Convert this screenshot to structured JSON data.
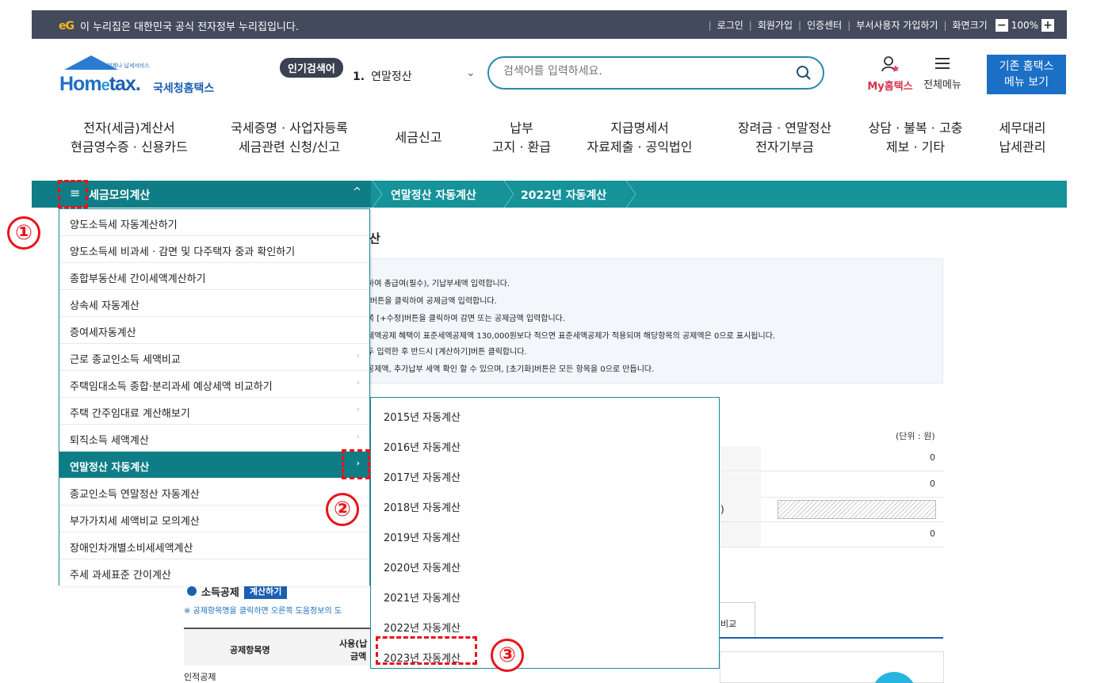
{
  "gov_bar": {
    "logo": "eG",
    "notice": "이 누리집은 대한민국 공식 전자정부 누리집입니다.",
    "links": [
      "로그인",
      "회원가입",
      "인증센터",
      "부서사용자 가입하기"
    ],
    "zoom_label": "화면크기",
    "zoom_minus": "−",
    "zoom_value": "100%",
    "zoom_plus": "+"
  },
  "header": {
    "logo_sub": "언제나 납세서비스",
    "logo_home": "Hom",
    "logo_e": "e",
    "logo_tax": "tax.",
    "logo_kr": "국세청홈택스",
    "popular_badge": "인기검색어",
    "popular_rank": "1.",
    "popular_keyword": "연말정산",
    "search_placeholder": "검색어를 입력하세요.",
    "my_label": "My홈택스",
    "allmenu_label": "전체메뉴",
    "old_menu_line1": "기존 홈택스",
    "old_menu_line2": "메뉴 보기"
  },
  "gnb": [
    {
      "l1": "전자(세금)계산서",
      "l2": "현금영수증 · 신용카드"
    },
    {
      "l1": "국세증명 · 사업자등록",
      "l2": "세금관련 신청/신고"
    },
    {
      "l1": "세금신고",
      "l2": ""
    },
    {
      "l1": "납부",
      "l2": "고지 · 환급"
    },
    {
      "l1": "지급명세서",
      "l2": "자료제출 · 공익법인"
    },
    {
      "l1": "장려금 · 연말정산",
      "l2": "전자기부금"
    },
    {
      "l1": "상담 · 불복 · 고충",
      "l2": "제보 · 기타"
    },
    {
      "l1": "세무대리",
      "l2": "납세관리"
    }
  ],
  "breadcrumb": {
    "menu_icon": "≡",
    "title": "세금모의계산",
    "toggle": "^",
    "crumb1": "연말정산 자동계산",
    "crumb2": "2022년 자동계산"
  },
  "menu": {
    "items": [
      {
        "label": "양도소득세 자동계산하기",
        "arrow": ""
      },
      {
        "label": "양도소득세 비과세 · 감면 및 다주택자 중과 확인하기",
        "arrow": ""
      },
      {
        "label": "종합부동산세 간이세액계산하기",
        "arrow": ""
      },
      {
        "label": "상속세 자동계산",
        "arrow": ""
      },
      {
        "label": "증여세자동계산",
        "arrow": ""
      },
      {
        "label": "근로 종교인소득 세액비교",
        "arrow": "›"
      },
      {
        "label": "주택임대소득 종합·분리과세 예상세액 비교하기",
        "arrow": "›"
      },
      {
        "label": "주택 간주임대료 계산해보기",
        "arrow": "›"
      },
      {
        "label": "퇴직소득 세액계산",
        "arrow": "›"
      },
      {
        "label": "연말정산 자동계산",
        "arrow": "›"
      },
      {
        "label": "종교인소득 연말정산 자동계산",
        "arrow": ""
      },
      {
        "label": "부가가치세 세액비교 모의계산",
        "arrow": ""
      },
      {
        "label": "장애인차개별소비세세액계산",
        "arrow": ""
      },
      {
        "label": "주세 과세표준 간이계산",
        "arrow": ""
      }
    ]
  },
  "submenu": {
    "items": [
      "2015년 자동계산",
      "2016년 자동계산",
      "2017년 자동계산",
      "2018년 자동계산",
      "2019년 자동계산",
      "2020년 자동계산",
      "2021년 자동계산",
      "2022년 자동계산",
      "2023년 자동계산"
    ]
  },
  "background": {
    "page_title": "산",
    "guide_lines": [
      "하여 총급여(필수), 기납부세액 입력합니다.",
      "]버튼을 클릭하여 공제금액 입력합니다.",
      "쪽 [+수정]버튼을 클릭하여 감면 또는 공제금액 입력합니다.",
      "세액공제 혜택이 표준세액공제액 130,000원보다 적으면 표준세액공제가 적용되며 해당항목의 공제액은 0으로 표시됩니다.",
      "두 입력한 후 반드시 [계산하기]버튼 클릭합니다.",
      "공제액, 추가납부 세액 확인 할 수 있으며, [초기화]버튼은 모든 항목을 0으로 만듭니다."
    ],
    "unit": "(단위 : 원)",
    "row_values": [
      "0",
      "0",
      "",
      "0"
    ],
    "paren": ")",
    "section_title": "소득공제",
    "section_button": "계산하기",
    "note": "※ 공제항목명을 클릭하면 오른쪽 도움정보의 도",
    "tab_label": "비교",
    "th1": "공제항목명",
    "th2": "사용(납",
    "th3": "금액",
    "row1": "인적공제"
  },
  "annotations": {
    "n1": "①",
    "n2": "②",
    "n3": "③",
    "color": "#e8141c"
  }
}
